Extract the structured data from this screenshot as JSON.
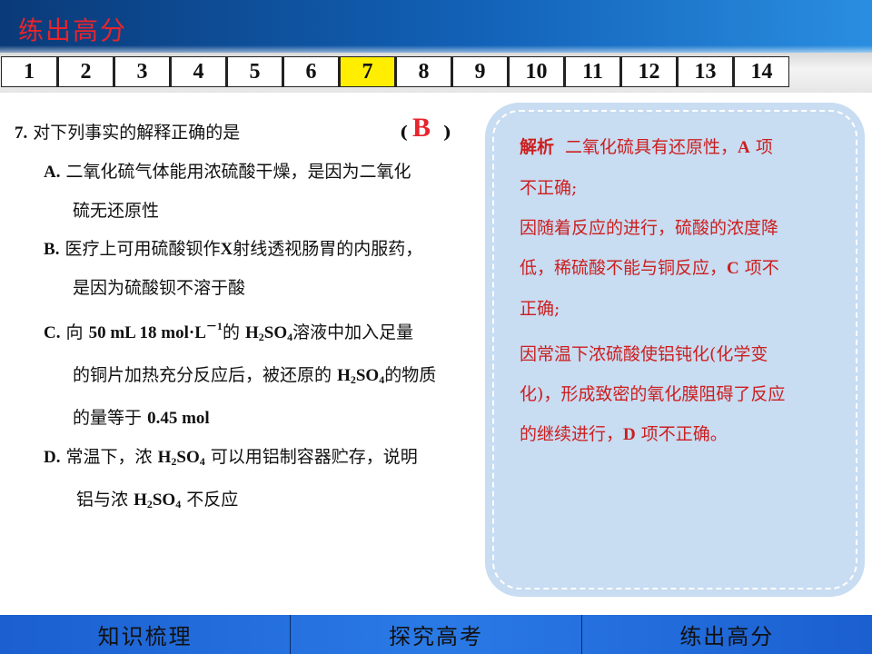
{
  "header": {
    "title": "练出高分"
  },
  "tabs": {
    "items": [
      "1",
      "2",
      "3",
      "4",
      "5",
      "6",
      "7",
      "8",
      "9",
      "10",
      "11",
      "12",
      "13",
      "14"
    ],
    "active": "7"
  },
  "question": {
    "number": "7",
    "stem": "对下列事实的解释正确的是",
    "answer": "B",
    "paren_open": "(",
    "paren_close": ")",
    "options": {
      "A": {
        "letter": "A",
        "line1": "二氧化硫气体能用浓硫酸干燥，是因为二氧化",
        "line2": "硫无还原性"
      },
      "B": {
        "letter": "B",
        "line1_pre": "医疗上可用硫酸钡作",
        "line1_x": "X",
        "line1_post": "射线透视肠胃的内服药，",
        "line2": "是因为硫酸钡不溶于酸"
      },
      "C": {
        "letter": "C",
        "pre": "向",
        "volume": "50 mL 18 mol·L",
        "exp": "－1",
        "of": "的",
        "h2so4_a": "H",
        "h2so4_b": "2",
        "h2so4_c": "SO",
        "h2so4_d": "4",
        "line1_post": "溶液中加入足量",
        "line2_pre": "的铜片加热充分反应后，被还原的",
        "line2_post": "的物质",
        "line3_pre": "的量等于",
        "line3_val": "0.45 mol"
      },
      "D": {
        "letter": "D",
        "line1_pre": "常温下，浓",
        "line1_post": "可以用铝制容器贮存，说明",
        "line2_pre": "铝与浓",
        "line2_post": "不反应"
      }
    }
  },
  "explanation": {
    "lead": "解析",
    "p1_pre": "二氧化硫具有还原性，",
    "p1_letter": "A",
    "p1_post": "项",
    "p1_line2": "不正确;",
    "p2_line1": "因随着反应的进行，硫酸的浓度降",
    "p2_line2_pre": "低，稀硫酸不能与铜反应，",
    "p2_letter": "C",
    "p2_line2_post": "项不",
    "p2_line3": "正确;",
    "p3_line1": "因常温下浓硫酸使铝钝化(化学变",
    "p3_line2": "化)，形成致密的氧化膜阻碍了反应",
    "p3_line3_pre": "的继续进行，",
    "p3_letter": "D",
    "p3_line3_post": "项不正确。"
  },
  "footer": {
    "items": [
      "知识梳理",
      "探究高考",
      "练出高分"
    ]
  }
}
